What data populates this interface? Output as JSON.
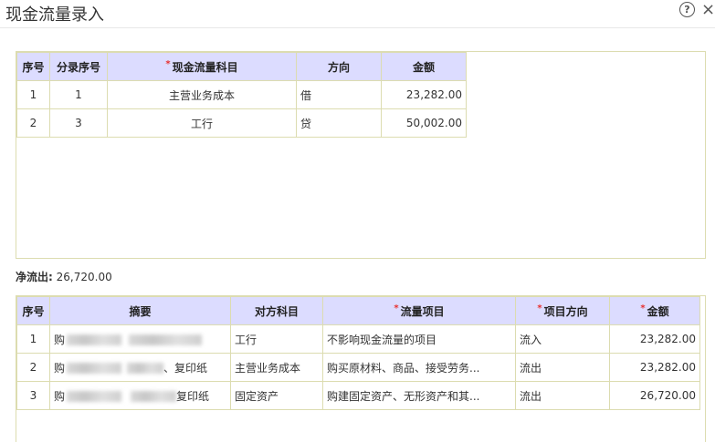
{
  "dialog": {
    "title": "现金流量录入",
    "help_label": "?",
    "close_label": "×"
  },
  "table1": {
    "headers": {
      "seq": "序号",
      "entry_seq": "分录序号",
      "subject": "现金流量科目",
      "direction": "方向",
      "amount": "金额"
    },
    "rows": [
      {
        "seq": "1",
        "entry_seq": "1",
        "subject": "主营业务成本",
        "direction": "借",
        "amount": "23,282.00"
      },
      {
        "seq": "2",
        "entry_seq": "3",
        "subject": "工行",
        "direction": "贷",
        "amount": "50,002.00"
      }
    ]
  },
  "net": {
    "label": "净流出:",
    "value": "26,720.00"
  },
  "table2": {
    "headers": {
      "seq": "序号",
      "summary": "摘要",
      "counter": "对方科目",
      "item": "流量项目",
      "item_dir": "项目方向",
      "amount": "金额"
    },
    "rows": [
      {
        "seq": "1",
        "summary_a": "购",
        "summary_b": "",
        "counter": "工行",
        "item": "不影响现金流量的项目",
        "item_dir": "流入",
        "amount": "23,282.00"
      },
      {
        "seq": "2",
        "summary_a": "购",
        "summary_b": "、复印纸",
        "counter": "主营业务成本",
        "item": "购买原材料、商品、接受劳务...",
        "item_dir": "流出",
        "amount": "23,282.00"
      },
      {
        "seq": "3",
        "summary_a": "购",
        "summary_b": "复印纸",
        "counter": "固定资产",
        "item": "购建固定资产、无形资产和其...",
        "item_dir": "流出",
        "amount": "26,720.00"
      }
    ]
  }
}
